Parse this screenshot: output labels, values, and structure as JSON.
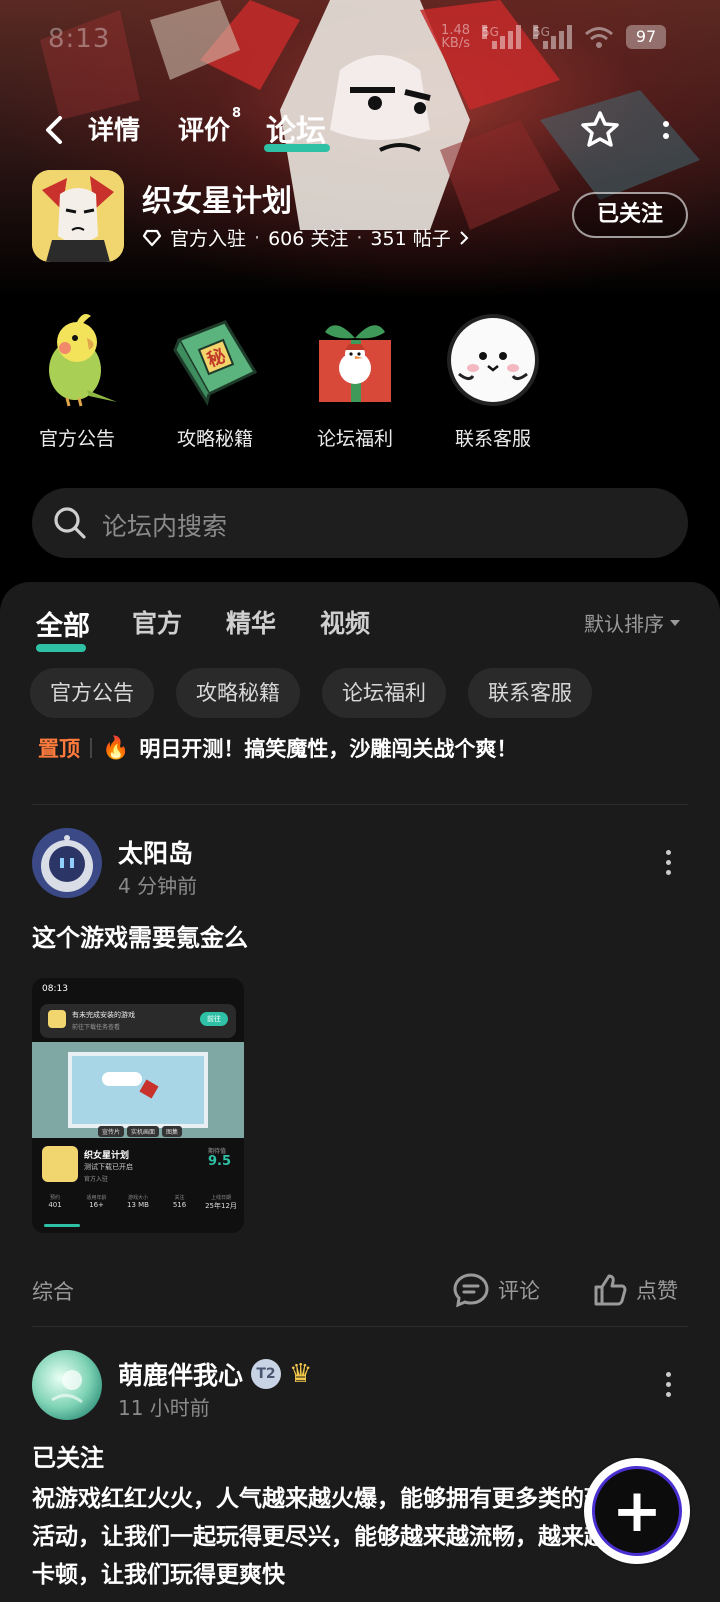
{
  "status_bar": {
    "time": "8:13",
    "net_speed_top": "1.48",
    "net_speed_bottom": "KB/s",
    "sig1_label": "5G",
    "sig2_label": "5G",
    "battery": "97"
  },
  "nav": {
    "tabs": [
      {
        "label": "详情"
      },
      {
        "label": "评价",
        "count": "8"
      },
      {
        "label": "论坛"
      }
    ],
    "active_tab": "论坛"
  },
  "game": {
    "title": "织女星计划",
    "official": "官方入驻",
    "followers": "606 关注",
    "posts": "351 帖子",
    "follow_button": "已关注"
  },
  "shortcuts": [
    {
      "label": "官方公告",
      "icon": "parrot-icon"
    },
    {
      "label": "攻略秘籍",
      "icon": "secret-book-icon"
    },
    {
      "label": "论坛福利",
      "icon": "gift-box-icon"
    },
    {
      "label": "联系客服",
      "icon": "service-blob-icon"
    }
  ],
  "search": {
    "placeholder": "论坛内搜索"
  },
  "feed": {
    "tabs": [
      "全部",
      "官方",
      "精华",
      "视频"
    ],
    "active": "全部",
    "sort": "默认排序",
    "chips": [
      "官方公告",
      "攻略秘籍",
      "论坛福利",
      "联系客服"
    ],
    "pinned": {
      "tag": "置顶",
      "text": "明日开测！搞笑魔性，沙雕闯关战个爽！"
    }
  },
  "posts": [
    {
      "author": "太阳岛",
      "time": "4 分钟前",
      "title": "这个游戏需要氪金么",
      "category": "综合",
      "comment": "评论",
      "like": "点赞",
      "screenshot": {
        "time": "08:13",
        "notice": "有未完成安装的游戏",
        "notice_sub": "前往下载任务查看",
        "notice_button": "前往",
        "tabs": [
          "宣传片",
          "实机画面",
          "图集"
        ],
        "game_name": "织女星计划",
        "game_sub": "测试下载已开启",
        "game_official": "官方入驻",
        "score_label": "期待值",
        "score": "9.5",
        "stats": [
          {
            "label": "预约",
            "value": "401"
          },
          {
            "label": "适用年龄",
            "value": "16+"
          },
          {
            "label": "游戏大小",
            "value": "13 MB"
          },
          {
            "label": "关注",
            "value": "516"
          },
          {
            "label": "上线日期",
            "value": "25年12月"
          }
        ]
      }
    },
    {
      "author": "萌鹿伴我心",
      "badge": "T2",
      "time": "11 小时前",
      "title": "已关注",
      "body": "祝游戏红红火火，人气越来越火爆，能够拥有更多类的玩法和活动，让我们一起玩得更尽兴，能够越来越流畅，越来越没有卡顿，让我们玩得更爽快"
    }
  ],
  "colors": {
    "accent": "#2fc1a6",
    "pinned": "#ff7a3d",
    "panel": "#1b1b1b"
  }
}
